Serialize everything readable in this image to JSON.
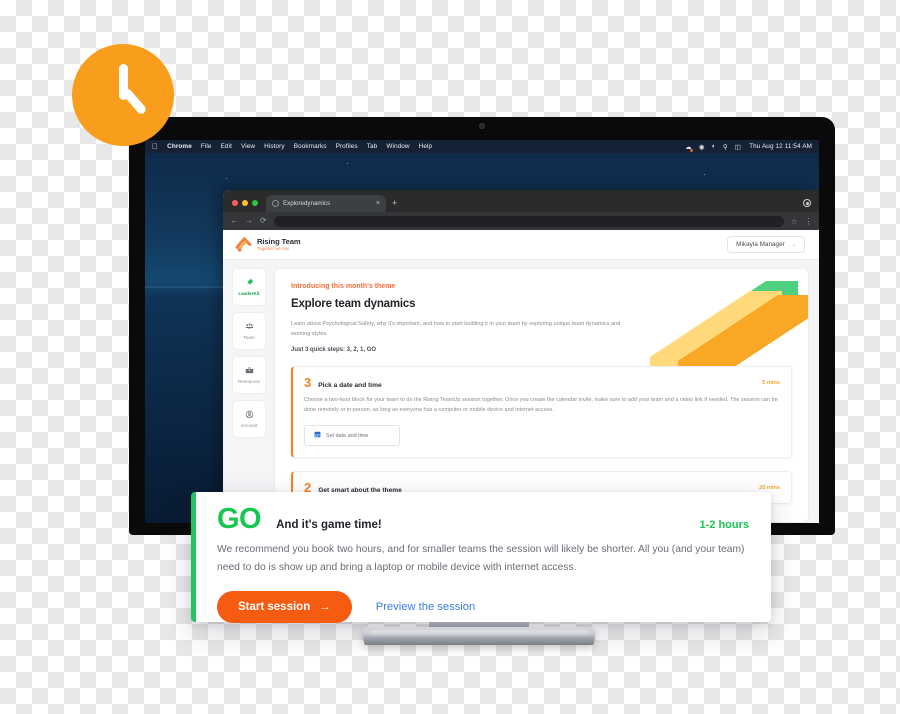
{
  "decor": {
    "clock_icon": "clock-icon",
    "ribbon_colors": [
      "#4ed07f",
      "#ffd97a",
      "#f9a825"
    ]
  },
  "os": {
    "menubar": {
      "apple_logo": "apple-logo-icon",
      "items": [
        "Chrome",
        "File",
        "Edit",
        "View",
        "History",
        "Bookmarks",
        "Profiles",
        "Tab",
        "Window",
        "Help"
      ],
      "status_icons": [
        "dropbox-icon",
        "control-center-icon",
        "wifi-icon",
        "search-icon",
        "screen-mirroring-icon"
      ],
      "clock": "Thu Aug 12  11:54 AM"
    }
  },
  "browser": {
    "tab": {
      "title": "Exploredynamics",
      "close_label": "×",
      "favicon": "page-favicon"
    },
    "new_tab_label": "+",
    "toolbar": {
      "back": "←",
      "forward": "→",
      "reload": "⟳",
      "url": "",
      "star": "☆",
      "menu": "⋮"
    }
  },
  "app": {
    "brand": {
      "name": "Rising Team",
      "tagline": "Together we rise"
    },
    "user_menu": {
      "name": "Mikayla Manager",
      "chevron": "⌄"
    },
    "sidebar": [
      {
        "label": "LeaderKit",
        "icon": "rocket-icon",
        "glyph": "✈",
        "active": true
      },
      {
        "label": "Team",
        "icon": "people-icon",
        "glyph": "⛭",
        "active": false
      },
      {
        "label": "Resources",
        "icon": "toolbox-icon",
        "glyph": "⛏",
        "active": false
      },
      {
        "label": "Account",
        "icon": "user-circle-icon",
        "glyph": "●",
        "active": false
      }
    ],
    "intro": {
      "kicker": "Introducing this month's theme",
      "title": "Explore team dynamics",
      "description": "Learn about Psychological Safety, why it's important, and how to start building it in your team by exploring unique team dynamics and working styles.",
      "steps_line": "Just 3 quick steps: 3, 2, 1, GO"
    },
    "steps": [
      {
        "number": "3",
        "title": "Pick a date and time",
        "time": "5 mins",
        "body": "Choose a two-hour block for your team to do the Rising TeamUp session together. Once you create the calendar invite, make sure to add your team and a video link if needed. The session can be done remotely or in-person, as long as everyone has a computer or mobile device and internet access.",
        "action_label": "Set date and time",
        "action_icon": "calendar-icon"
      },
      {
        "number": "2",
        "title": "Get smart about the theme",
        "time": "20 mins",
        "body": "",
        "action_label": "",
        "action_icon": ""
      }
    ]
  },
  "go_card": {
    "logo": "GO",
    "tagline": "And it's game time!",
    "duration": "1-2 hours",
    "description": "We recommend you book two hours, and for smaller teams the session will likely be shorter. All you (and your team) need to do is show up and bring a laptop or mobile device with internet access.",
    "primary_button": "Start session",
    "primary_button_arrow": "→",
    "secondary_link": "Preview the session"
  },
  "colors": {
    "orange": "#f68220",
    "green": "#22c55e",
    "blue_link": "#3b7ddd",
    "cta_orange": "#f65b12"
  }
}
